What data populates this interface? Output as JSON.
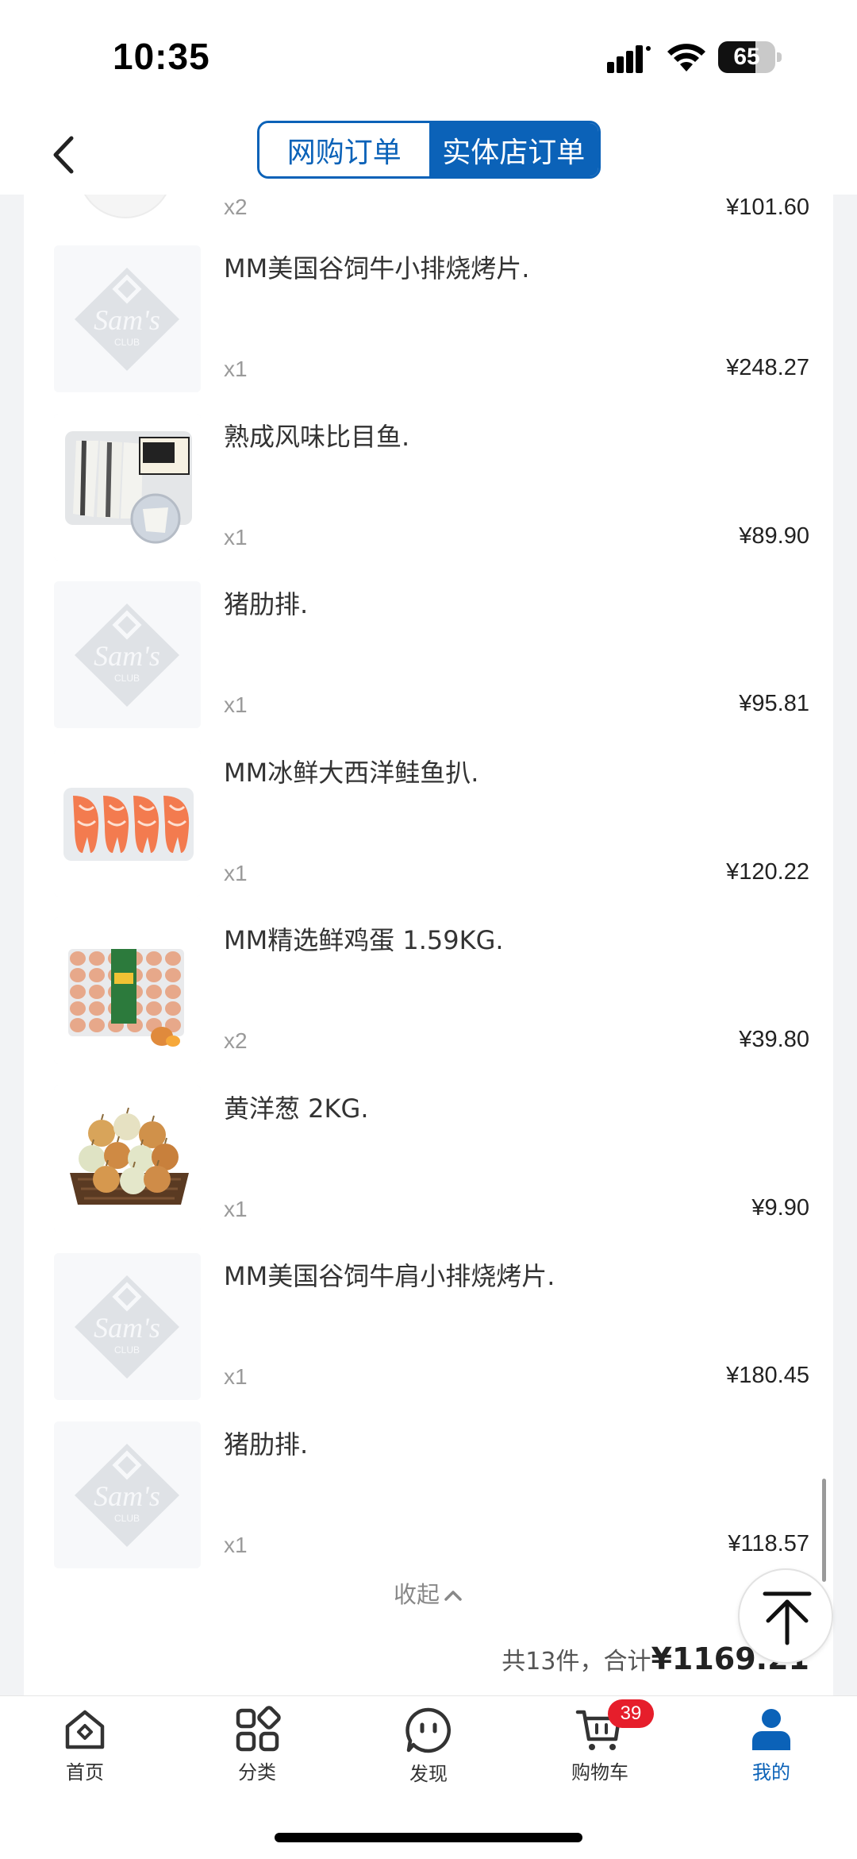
{
  "status_bar": {
    "time": "10:35",
    "battery": "65",
    "battery_level": 0.65
  },
  "header": {
    "tabs": [
      {
        "label": "网购订单",
        "active": false
      },
      {
        "label": "实体店订单",
        "active": true
      }
    ]
  },
  "order": {
    "partial_item": {
      "qty": "x2",
      "price": "¥101.60"
    },
    "items": [
      {
        "name": "MM美国谷饲牛小排烧烤片.",
        "qty": "x1",
        "price": "¥248.27",
        "image": "sams-club-placeholder"
      },
      {
        "name": "熟成风味比目鱼.",
        "qty": "x1",
        "price": "¥89.90",
        "image": "halibut-fillet-tray"
      },
      {
        "name": "猪肋排.",
        "qty": "x1",
        "price": "¥95.81",
        "image": "sams-club-placeholder"
      },
      {
        "name": "MM冰鲜大西洋鲑鱼扒.",
        "qty": "x1",
        "price": "¥120.22",
        "image": "salmon-steak-tray"
      },
      {
        "name": "MM精选鲜鸡蛋 1.59KG.",
        "qty": "x2",
        "price": "¥39.80",
        "image": "egg-carton"
      },
      {
        "name": "黄洋葱 2KG.",
        "qty": "x1",
        "price": "¥9.90",
        "image": "onion-basket"
      },
      {
        "name": "MM美国谷饲牛肩小排烧烤片.",
        "qty": "x1",
        "price": "¥180.45",
        "image": "sams-club-placeholder"
      },
      {
        "name": "猪肋排.",
        "qty": "x1",
        "price": "¥118.57",
        "image": "sams-club-placeholder"
      }
    ],
    "placeholder_logo_text": "Sam's",
    "placeholder_logo_sub": "CLUB",
    "collapse_label": "收起",
    "total_prefix": "共13件，合计",
    "total_amount": "¥1169.21"
  },
  "tab_bar": {
    "tabs": [
      {
        "label": "首页",
        "icon": "home-icon"
      },
      {
        "label": "分类",
        "icon": "category-icon"
      },
      {
        "label": "发现",
        "icon": "discover-icon"
      },
      {
        "label": "购物车",
        "icon": "cart-icon",
        "badge": "39"
      },
      {
        "label": "我的",
        "icon": "profile-icon",
        "active": true
      }
    ]
  },
  "colors": {
    "accent": "#0b62b8",
    "badge": "#e61e2b",
    "background": "#f2f3f5"
  }
}
